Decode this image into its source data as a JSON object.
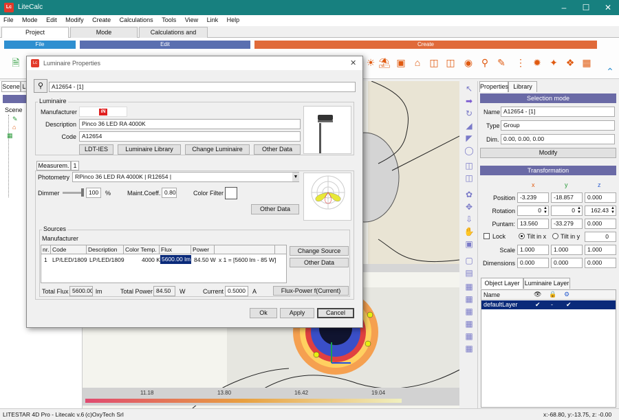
{
  "app": {
    "title": "LiteCalc",
    "logo": "Lc"
  },
  "menu": [
    "File",
    "Mode",
    "Edit",
    "Modify",
    "Create",
    "Calculations",
    "Tools",
    "View",
    "Link",
    "Help"
  ],
  "ribbon_tabs": [
    "Project",
    "Mode",
    "Calculations and Results"
  ],
  "ribbon_groups": {
    "file": "File",
    "edit": "Edit",
    "create": "Create"
  },
  "left_panel": {
    "tab1": "Scene",
    "tab2": "L",
    "tree_root": "Scene"
  },
  "canvas": {
    "ruler_ticks": [
      "11.18",
      "13.80",
      "16.42",
      "19.04"
    ]
  },
  "right_panel": {
    "tabs": [
      "Properties",
      "Library"
    ],
    "selection_mode": "Selection mode",
    "name_label": "Name",
    "name_value": "A12654 - [1]",
    "type_label": "Type",
    "type_value": "Group",
    "dim_label": "Dim.",
    "dim_value": "0.00, 0.00, 0.00",
    "modify": "Modify",
    "transformation": "Transformation",
    "axes": [
      "x",
      "y",
      "z"
    ],
    "position_label": "Position",
    "position": [
      "-3.239",
      "-18.857",
      "0.000"
    ],
    "rotation_label": "Rotation",
    "rotation": [
      "0",
      "0",
      "162.43"
    ],
    "puntam_label": "Puntam:",
    "puntam": [
      "13.560",
      "-33.279",
      "0.000"
    ],
    "lock_label": "Lock",
    "tilt_x_label": "Tilt in x",
    "tilt_y_label": "Tilt in y",
    "tilt_value": "0",
    "scale_label": "Scale",
    "scale": [
      "1.000",
      "1.000",
      "1.000"
    ],
    "dimensions_label": "Dimensions",
    "dimensions": [
      "0.000",
      "0.000",
      "0.000"
    ],
    "layer_tabs": [
      "Object Layer",
      "Luminaire Layer"
    ],
    "layer_col_name": "Name",
    "layer_row": {
      "name": "defaultLayer",
      "visible": "✔",
      "locked": "-",
      "active": "✔"
    }
  },
  "dialog": {
    "title": "Luminaire Properties",
    "header_value": "A12654 - [1]",
    "luminaire_group": "Luminaire",
    "manufacturer_label": "Manufacturer",
    "manufacturer_logo": "iN",
    "description_label": "Description",
    "description_value": "Pinco 36 LED RA 4000K",
    "code_label": "Code",
    "code_value": "A12654",
    "btn_ldt": "LDT-IES",
    "btn_library": "Luminaire Library",
    "btn_change": "Luminaire Library",
    "btn_change_lum": "Change Luminaire",
    "btn_other1": "Other Data",
    "meas_tab": "Measurem.",
    "meas_tab2": "1",
    "photometry_label": "Photometry",
    "photometry_value": "RPinco 36 LED RA 4000K | R12654 |",
    "dimmer_label": "Dimmer",
    "dimmer_value": "100",
    "dimmer_unit": "%",
    "maint_label": "Maint.Coeff.",
    "maint_value": "0.80",
    "filter_label": "Color Filter",
    "btn_other2": "Other Data",
    "sources_group": "Sources",
    "sources_manufacturer": "Manufacturer",
    "columns": [
      "nr.",
      "Code",
      "Description",
      "Color Temp.",
      "Flux",
      "Power"
    ],
    "row": {
      "nr": "1",
      "code": "LP/LED/1809",
      "description": "LP/LED/1809",
      "temp": "4000 K",
      "flux": "5600.00 lm",
      "power": "84.50 W",
      "formula": "x 1 = [5600 lm - 85 W]"
    },
    "btn_change_source": "Change Source",
    "btn_other3": "Other Data",
    "total_flux_label": "Total Flux",
    "total_flux_value": "5600.00",
    "total_flux_unit": "lm",
    "total_power_label": "Total Power",
    "total_power_value": "84.50",
    "total_power_unit": "W",
    "current_label": "Current",
    "current_value": "0.5000",
    "current_unit": "A",
    "btn_flux_power": "Flux-Power f(Current)",
    "ok": "Ok",
    "apply": "Apply",
    "cancel": "Cancel"
  },
  "status": {
    "left": "LITESTAR 4D Pro - Litecalc v.6",
    "mid": "(c)OxyTech Srl",
    "coords": "x:-68.80, y:-13.75, z: -0.00"
  },
  "colors": {
    "titlebar": "#17807f",
    "file_group": "#2e8fd0",
    "edit_group": "#5a6fb0",
    "create_group": "#e06a3a",
    "panel_header": "#6a6aa6"
  }
}
